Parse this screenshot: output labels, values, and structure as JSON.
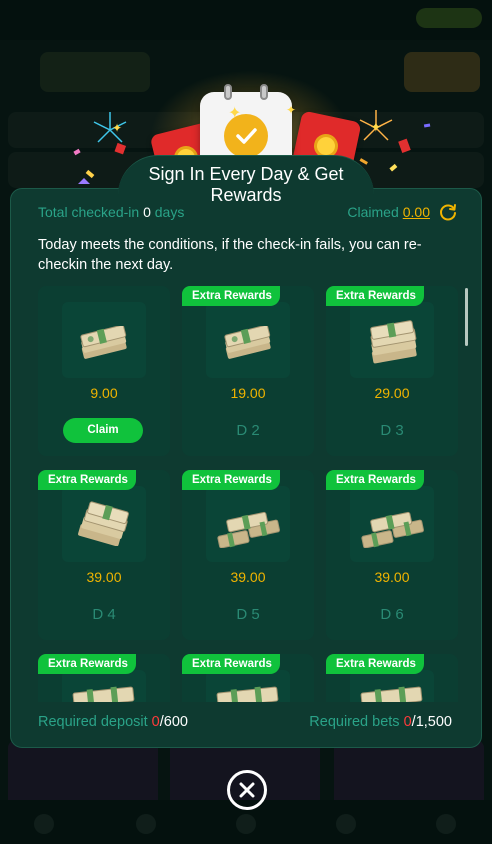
{
  "modal": {
    "title_line1": "Sign In Every Day & Get",
    "title_line2": "Rewards",
    "total_label": "Total checked-in",
    "total_value": "0",
    "total_unit": "days",
    "claimed_label": "Claimed",
    "claimed_value": "0.00",
    "notice": "Today meets the conditions, if the check-in fails, you can re-checkin the next day.",
    "extra_tag": "Extra Rewards",
    "cards": [
      {
        "amount": "9.00",
        "action": "Claim",
        "extra": false
      },
      {
        "amount": "19.00",
        "day": "D 2",
        "extra": true
      },
      {
        "amount": "29.00",
        "day": "D 3",
        "extra": true
      },
      {
        "amount": "39.00",
        "day": "D 4",
        "extra": true
      },
      {
        "amount": "39.00",
        "day": "D 5",
        "extra": true
      },
      {
        "amount": "39.00",
        "day": "D 6",
        "extra": true
      },
      {
        "extra": true
      },
      {
        "extra": true
      },
      {
        "extra": true
      }
    ],
    "required_deposit_label": "Required deposit",
    "required_deposit_current": "0",
    "required_deposit_target": "/600",
    "required_bets_label": "Required bets",
    "required_bets_current": "0",
    "required_bets_target": "/1,500"
  },
  "icons": {
    "refresh": "refresh-icon",
    "close": "close-icon",
    "money": "money-stack-icon",
    "calendar": "calendar-check-icon",
    "envelope": "red-envelope-icon"
  },
  "colors": {
    "accent_green": "#10c23c",
    "amount_gold": "#f0b400",
    "label_teal": "#2aa388",
    "modal_bg": "#0e3a30",
    "warning_red": "#ff3b3b"
  }
}
